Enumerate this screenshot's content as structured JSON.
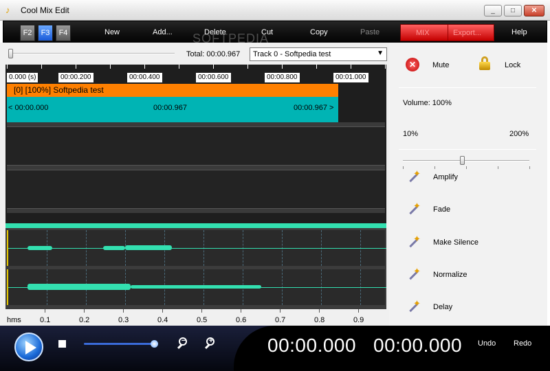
{
  "window": {
    "title": "Cool Mix Edit",
    "min": "_",
    "max": "□",
    "close": "✕"
  },
  "toolbar": {
    "fkeys": [
      "F2",
      "F3",
      "F4"
    ],
    "new": "New",
    "add": "Add...",
    "delete": "Delete",
    "cut": "Cut",
    "copy": "Copy",
    "paste": "Paste",
    "mix": "MIX",
    "export": "Export...",
    "help": "Help"
  },
  "watermark": "SOFTPEDIA",
  "header": {
    "total": "Total: 00:00.967",
    "track_select": "Track 0 - Softpedia test"
  },
  "ruler": {
    "labels": [
      "0.000 (s)",
      "00:00.200",
      "00:00.400",
      "00:00.600",
      "00:00.800",
      "00:01.000"
    ]
  },
  "track": {
    "title": "[0] [100%] Softpedia test",
    "start": "< 00:00.000",
    "mid": "00:00.967",
    "end": "00:00.967 >"
  },
  "hms": {
    "unit": "hms",
    "ticks": [
      "0.1",
      "0.2",
      "0.3",
      "0.4",
      "0.5",
      "0.6",
      "0.7",
      "0.8",
      "0.9"
    ]
  },
  "right": {
    "mute": "Mute",
    "lock": "Lock",
    "volume_label": "Volume: 100%",
    "volume_value": 100,
    "volume_min": "10%",
    "volume_max": "200%",
    "effects": [
      "Amplify",
      "Fade",
      "Make Silence",
      "Normalize",
      "Delay"
    ]
  },
  "transport": {
    "position": "00:00.000",
    "length": "00:00.000",
    "undo": "Undo",
    "redo": "Redo"
  },
  "colors": {
    "track_header": "#ff8000",
    "track_body": "#00b4b4",
    "waveform": "#33e0b0",
    "fkey_active": "#1a5ad8"
  }
}
